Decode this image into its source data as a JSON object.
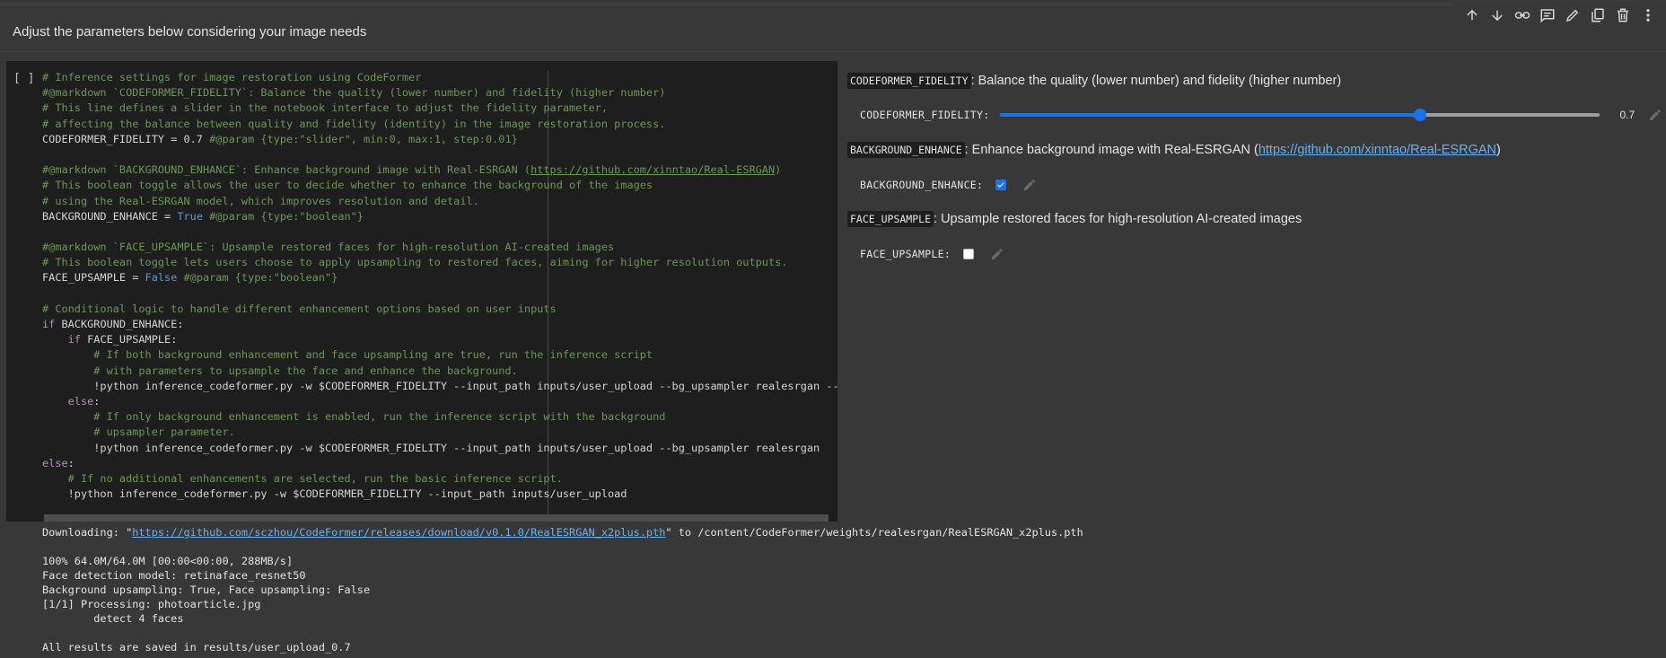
{
  "toolbar": {
    "icons": [
      "arrow-up-icon",
      "arrow-down-icon",
      "link-icon",
      "comment-icon",
      "edit-icon",
      "copy-icon",
      "delete-icon",
      "more-icon"
    ]
  },
  "text_cell": {
    "text": "Adjust the parameters below considering your image needs"
  },
  "code_cell": {
    "run_indicator": "[ ]",
    "lines": [
      [
        {
          "t": "# Inference settings for image restoration using CodeFormer",
          "c": "c"
        }
      ],
      [
        {
          "t": "#@markdown `CODEFORMER_FIDELITY`: Balance the quality (lower number) and fidelity (higher number)",
          "c": "c"
        }
      ],
      [
        {
          "t": "# This line defines a slider in the notebook interface to adjust the fidelity parameter,",
          "c": "c"
        }
      ],
      [
        {
          "t": "# affecting the balance between quality and fidelity (identity) in the image restoration process.",
          "c": "c"
        }
      ],
      [
        {
          "t": "CODEFORMER_FIDELITY = 0.7 ",
          "c": ""
        },
        {
          "t": "#@param {type:\"slider\", min:0, max:1, step:0.01}",
          "c": "c"
        }
      ],
      [
        {
          "t": "",
          "c": ""
        }
      ],
      [
        {
          "t": "#@markdown `BACKGROUND_ENHANCE`: Enhance background image with Real-ESRGAN (",
          "c": "c"
        },
        {
          "t": "https://github.com/xinntao/Real-ESRGAN",
          "c": "c u"
        },
        {
          "t": ")",
          "c": "c"
        }
      ],
      [
        {
          "t": "# This boolean toggle allows the user to decide whether to enhance the background of the images",
          "c": "c"
        }
      ],
      [
        {
          "t": "# using the Real-ESRGAN model, which improves resolution and detail.",
          "c": "c"
        }
      ],
      [
        {
          "t": "BACKGROUND_ENHANCE = ",
          "c": ""
        },
        {
          "t": "True",
          "c": "b"
        },
        {
          "t": " #@param {type:\"boolean\"}",
          "c": "c"
        }
      ],
      [
        {
          "t": "",
          "c": ""
        }
      ],
      [
        {
          "t": "#@markdown `FACE_UPSAMPLE`: Upsample restored faces for high-resolution AI-created images",
          "c": "c"
        }
      ],
      [
        {
          "t": "# This boolean toggle lets users choose to apply upsampling to restored faces, aiming for higher resolution outputs.",
          "c": "c"
        }
      ],
      [
        {
          "t": "FACE_UPSAMPLE = ",
          "c": ""
        },
        {
          "t": "False",
          "c": "b"
        },
        {
          "t": " #@param {type:\"boolean\"}",
          "c": "c"
        }
      ],
      [
        {
          "t": "",
          "c": ""
        }
      ],
      [
        {
          "t": "# Conditional logic to handle different enhancement options based on user inputs",
          "c": "c"
        }
      ],
      [
        {
          "t": "if",
          "c": "k"
        },
        {
          "t": " BACKGROUND_ENHANCE:",
          "c": ""
        }
      ],
      [
        {
          "t": "    ",
          "c": ""
        },
        {
          "t": "if",
          "c": "k"
        },
        {
          "t": " FACE_UPSAMPLE:",
          "c": ""
        }
      ],
      [
        {
          "t": "        # If both background enhancement and face upsampling are true, run the inference script",
          "c": "c"
        }
      ],
      [
        {
          "t": "        # with parameters to upsample the face and enhance the background.",
          "c": "c"
        }
      ],
      [
        {
          "t": "        !python inference_codeformer.py -w $CODEFORMER_FIDELITY --input_path inputs/user_upload --bg_upsampler realesrgan --fac",
          "c": ""
        }
      ],
      [
        {
          "t": "    ",
          "c": ""
        },
        {
          "t": "else",
          "c": "k"
        },
        {
          "t": ":",
          "c": ""
        }
      ],
      [
        {
          "t": "        # If only background enhancement is enabled, run the inference script with the background",
          "c": "c"
        }
      ],
      [
        {
          "t": "        # upsampler parameter.",
          "c": "c"
        }
      ],
      [
        {
          "t": "        !python inference_codeformer.py -w $CODEFORMER_FIDELITY --input_path inputs/user_upload --bg_upsampler realesrgan",
          "c": ""
        }
      ],
      [
        {
          "t": "else",
          "c": "k"
        },
        {
          "t": ":",
          "c": ""
        }
      ],
      [
        {
          "t": "    # If no additional enhancements are selected, run the basic inference script.",
          "c": "c"
        }
      ],
      [
        {
          "t": "    !python inference_codeformer.py -w $CODEFORMER_FIDELITY --input_path inputs/user_upload",
          "c": ""
        }
      ]
    ]
  },
  "form": {
    "fidelity": {
      "tag": "CODEFORMER_FIDELITY",
      "description": ": Balance the quality (lower number) and fidelity (higher number)",
      "label": "CODEFORMER_FIDELITY:",
      "value": 0.7,
      "value_text": "0.7"
    },
    "background": {
      "tag": "BACKGROUND_ENHANCE",
      "description_prefix": ": Enhance background image with Real-ESRGAN (",
      "link": "https://github.com/xinntao/Real-ESRGAN",
      "description_suffix": ")",
      "label": "BACKGROUND_ENHANCE:",
      "checked": true
    },
    "face": {
      "tag": "FACE_UPSAMPLE",
      "description": ": Upsample restored faces for high-resolution AI-created images",
      "label": "FACE_UPSAMPLE:",
      "checked": false
    }
  },
  "output": {
    "download_prefix": "Downloading: \"",
    "download_link": "https://github.com/sczhou/CodeFormer/releases/download/v0.1.0/RealESRGAN_x2plus.pth",
    "download_suffix": "\" to /content/CodeFormer/weights/realesrgan/RealESRGAN_x2plus.pth",
    "lines": [
      "",
      "100% 64.0M/64.0M [00:00<00:00, 288MB/s]",
      "Face detection model: retinaface_resnet50",
      "Background upsampling: True, Face upsampling: False",
      "[1/1] Processing: photoarticle.jpg",
      "\tdetect 4 faces",
      "",
      "All results are saved in results/user_upload_0.7"
    ]
  },
  "colors": {
    "accent": "#1a73e8",
    "comment": "#6a9955",
    "keyword": "#c586c0",
    "builtin": "#569cd6"
  }
}
